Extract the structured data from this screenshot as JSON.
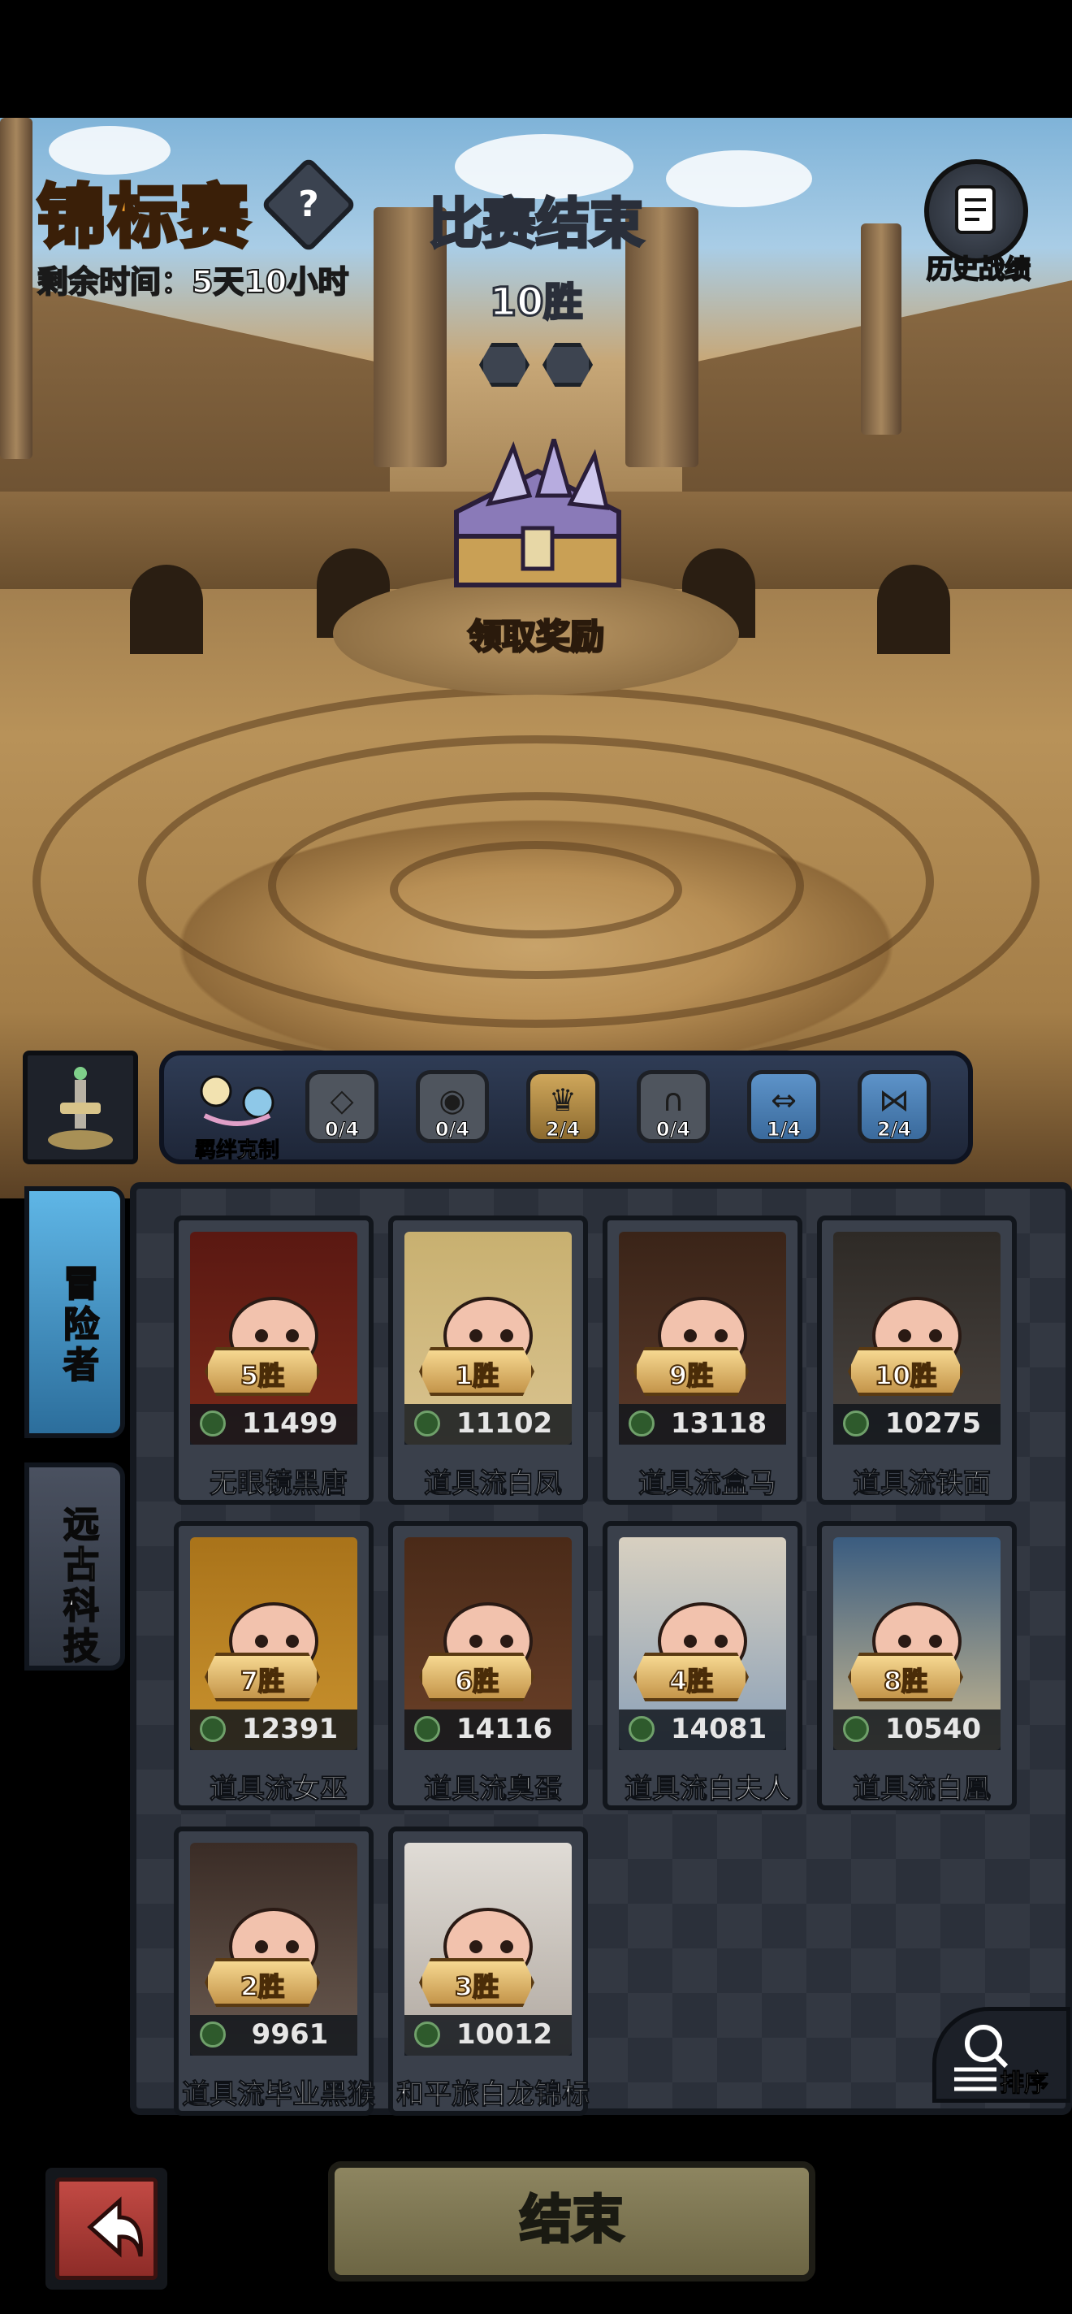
{
  "header": {
    "title": "锦标赛",
    "help_icon": "question-mark-icon",
    "help_label": "?",
    "timer": "剩余时间：5天10小时",
    "status": "比赛结束",
    "wins": "10胜",
    "history_label": "历史战绩",
    "history_icon": "scroll-icon"
  },
  "reward": {
    "label": "领取奖励",
    "icon": "treasure-chest-icon"
  },
  "synergy": {
    "main_label": "羁绊克制",
    "badges": [
      {
        "icon": "diamond-icon",
        "count": "0/4",
        "state": "off"
      },
      {
        "icon": "eye-icon",
        "count": "0/4",
        "state": "off"
      },
      {
        "icon": "crown-icon",
        "count": "2/4",
        "state": "on"
      },
      {
        "icon": "arch-icon",
        "count": "0/4",
        "state": "off"
      },
      {
        "icon": "arrows-icon",
        "count": "1/4",
        "state": "blue"
      },
      {
        "icon": "bowtie-icon",
        "count": "2/4",
        "state": "blue"
      }
    ]
  },
  "tabs": [
    {
      "label": "冒险者",
      "active": true
    },
    {
      "label": "远古科技",
      "active": false
    }
  ],
  "roster": [
    {
      "wins": "5胜",
      "score": "11499",
      "name": "无眼镜黑唐",
      "skin": "#7a2a1a",
      "hair": "#5a1812"
    },
    {
      "wins": "1胜",
      "score": "11102",
      "name": "道具流白凤",
      "skin": "#d9c38f",
      "hair": "#c8b070"
    },
    {
      "wins": "9胜",
      "score": "13118",
      "name": "道具流盒马",
      "skin": "#5b3a2a",
      "hair": "#3a2418"
    },
    {
      "wins": "10胜",
      "score": "10275",
      "name": "道具流铁面",
      "skin": "#4a4440",
      "hair": "#2e2a26"
    },
    {
      "wins": "7胜",
      "score": "12391",
      "name": "道具流女巫",
      "skin": "#c9922e",
      "hair": "#a9731a"
    },
    {
      "wins": "6胜",
      "score": "14116",
      "name": "道具流臭蛋",
      "skin": "#6a4028",
      "hair": "#4a2a18"
    },
    {
      "wins": "4胜",
      "score": "14081",
      "name": "道具流白夫人",
      "skin": "#8aa0b8",
      "hair": "#d8d0c0"
    },
    {
      "wins": "8胜",
      "score": "10540",
      "name": "道具流白凰",
      "skin": "#c8b890",
      "hair": "#3a5c80"
    },
    {
      "wins": "2胜",
      "score": "9961",
      "name": "道具流毕业黑猴",
      "skin": "#6a5a50",
      "hair": "#3a2c26"
    },
    {
      "wins": "3胜",
      "score": "10012",
      "name": "和平旅白龙锦标",
      "skin": "#b0a8a0",
      "hair": "#e0dcd6"
    }
  ],
  "sort": {
    "label": "排序",
    "icon": "magnifier-list-icon"
  },
  "footer": {
    "back_icon": "return-arrow-icon",
    "end_label": "结束"
  }
}
